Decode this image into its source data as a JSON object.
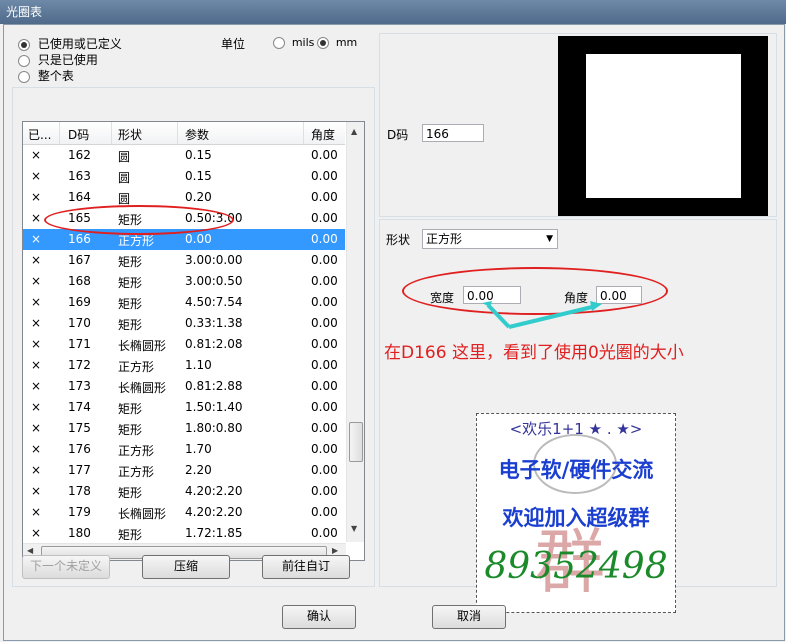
{
  "window": {
    "title": "光圈表"
  },
  "filter": {
    "options": [
      "已使用或已定义",
      "只是已使用",
      "整个表"
    ],
    "selected_index": 0
  },
  "unit": {
    "label": "单位",
    "options": [
      "mils",
      "mm"
    ],
    "selected": "mm"
  },
  "table": {
    "columns": [
      "已...",
      "D码",
      "形状",
      "参数",
      "角度"
    ],
    "rows": [
      {
        "used": "×",
        "d": "162",
        "shape": "圆",
        "param": "0.15",
        "angle": "0.00"
      },
      {
        "used": "×",
        "d": "163",
        "shape": "圆",
        "param": "0.15",
        "angle": "0.00"
      },
      {
        "used": "×",
        "d": "164",
        "shape": "圆",
        "param": "0.20",
        "angle": "0.00"
      },
      {
        "used": "×",
        "d": "165",
        "shape": "矩形",
        "param": "0.50:3.00",
        "angle": "0.00"
      },
      {
        "used": "×",
        "d": "166",
        "shape": "正方形",
        "param": "0.00",
        "angle": "0.00",
        "selected": true
      },
      {
        "used": "×",
        "d": "167",
        "shape": "矩形",
        "param": "3.00:0.00",
        "angle": "0.00"
      },
      {
        "used": "×",
        "d": "168",
        "shape": "矩形",
        "param": "3.00:0.50",
        "angle": "0.00"
      },
      {
        "used": "×",
        "d": "169",
        "shape": "矩形",
        "param": "4.50:7.54",
        "angle": "0.00"
      },
      {
        "used": "×",
        "d": "170",
        "shape": "矩形",
        "param": "0.33:1.38",
        "angle": "0.00"
      },
      {
        "used": "×",
        "d": "171",
        "shape": "长椭圆形",
        "param": "0.81:2.08",
        "angle": "0.00"
      },
      {
        "used": "×",
        "d": "172",
        "shape": "正方形",
        "param": "1.10",
        "angle": "0.00"
      },
      {
        "used": "×",
        "d": "173",
        "shape": "长椭圆形",
        "param": "0.81:2.88",
        "angle": "0.00"
      },
      {
        "used": "×",
        "d": "174",
        "shape": "矩形",
        "param": "1.50:1.40",
        "angle": "0.00"
      },
      {
        "used": "×",
        "d": "175",
        "shape": "矩形",
        "param": "1.80:0.80",
        "angle": "0.00"
      },
      {
        "used": "×",
        "d": "176",
        "shape": "正方形",
        "param": "1.70",
        "angle": "0.00"
      },
      {
        "used": "×",
        "d": "177",
        "shape": "正方形",
        "param": "2.20",
        "angle": "0.00"
      },
      {
        "used": "×",
        "d": "178",
        "shape": "矩形",
        "param": "4.20:2.20",
        "angle": "0.00"
      },
      {
        "used": "×",
        "d": "179",
        "shape": "长椭圆形",
        "param": "4.20:2.20",
        "angle": "0.00"
      },
      {
        "used": "×",
        "d": "180",
        "shape": "矩形",
        "param": "1.72:1.85",
        "angle": "0.00"
      }
    ]
  },
  "buttons": {
    "next_undefined": "下一个未定义",
    "compress": "压缩",
    "goto_custom": "前往自订",
    "ok": "确认",
    "cancel": "取消"
  },
  "details": {
    "dcode_label": "D码",
    "dcode_value": "166",
    "shape_label": "形状",
    "shape_value": "正方形",
    "width_label": "宽度",
    "width_value": "0.00",
    "angle_label": "角度",
    "angle_value": "0.00"
  },
  "annotation": {
    "text": "在D166 这里，看到了使用0光圈的大小",
    "color": "#e02020",
    "arrow_color": "#33cccc"
  },
  "promo": {
    "header": "<欢乐1+1 ★ . ★>",
    "line1": "电子软/硬件交流",
    "line2": "欢迎加入超级群",
    "number": "89352498",
    "stamp": "群",
    "colors": {
      "blue": "#1a3fd0",
      "green": "#1a8a2a",
      "stamp": "#c06060"
    }
  }
}
